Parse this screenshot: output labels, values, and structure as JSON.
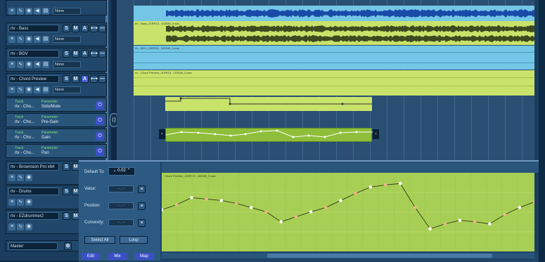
{
  "tracks": [
    {
      "name": "",
      "mode": "None"
    },
    {
      "name": "rtv - Bass",
      "mode": "None"
    },
    {
      "name": "rtv - BGV",
      "mode": "None"
    },
    {
      "name": "rtv - Chord Preview",
      "mode": "None"
    }
  ],
  "param_tracks": [
    {
      "track_label": "Track",
      "track_val": "rtv - Cho...",
      "param_label": "Parameter",
      "param_val": "Solo/Mute"
    },
    {
      "track_label": "Track",
      "track_val": "rtv - Cho...",
      "param_label": "Parameter",
      "param_val": "Pre-Gain"
    },
    {
      "track_label": "Track",
      "track_val": "rtv - Cho...",
      "param_label": "Parameter",
      "param_val": "Gain"
    },
    {
      "track_label": "Track",
      "track_val": "rtv - Cho...",
      "param_label": "Parameter",
      "param_val": "Pan"
    }
  ],
  "lower_tracks": [
    {
      "name": "rtv - Brownsion Pro x64"
    },
    {
      "name": "rtv - Drums"
    },
    {
      "name": "rtv - EZdrummer2"
    }
  ],
  "master": {
    "name": "Master"
  },
  "buttons": {
    "s": "S",
    "m": "M",
    "a": "A"
  },
  "clips": {
    "lane1": "",
    "lane2": "rtv - Bass_21RR13 - 102530_0.wav",
    "lane3": "rtv - BGV_21RR13 - 102530_0.wav",
    "lane4": "rtv - Chord Preview_21RR13 - 102530_0.wav"
  },
  "editor": {
    "default_to_label": "Default To:",
    "default_to_value": "0.02",
    "value_label": "Value:",
    "position_label": "Position:",
    "convexity_label": "Convexity:",
    "select_all": "Select All",
    "loop": "Loop",
    "tabs": [
      "Edit",
      "Mix",
      "Map"
    ],
    "clip_label": "Chord Preview_21RR13 - 102530_0.wav",
    "drop_placeholder": "- . -"
  },
  "automation_points": [
    0.55,
    0.62,
    0.72,
    0.7,
    0.68,
    0.64,
    0.58,
    0.52,
    0.38,
    0.45,
    0.52,
    0.58,
    0.68,
    0.78,
    0.87,
    0.9,
    0.92,
    0.58,
    0.28,
    0.35,
    0.4,
    0.38,
    0.35,
    0.48,
    0.58,
    0.66
  ],
  "colors": {
    "accent": "#3b4fc6",
    "clip_green": "#c9e36a",
    "clip_blue": "#74c6e6"
  }
}
